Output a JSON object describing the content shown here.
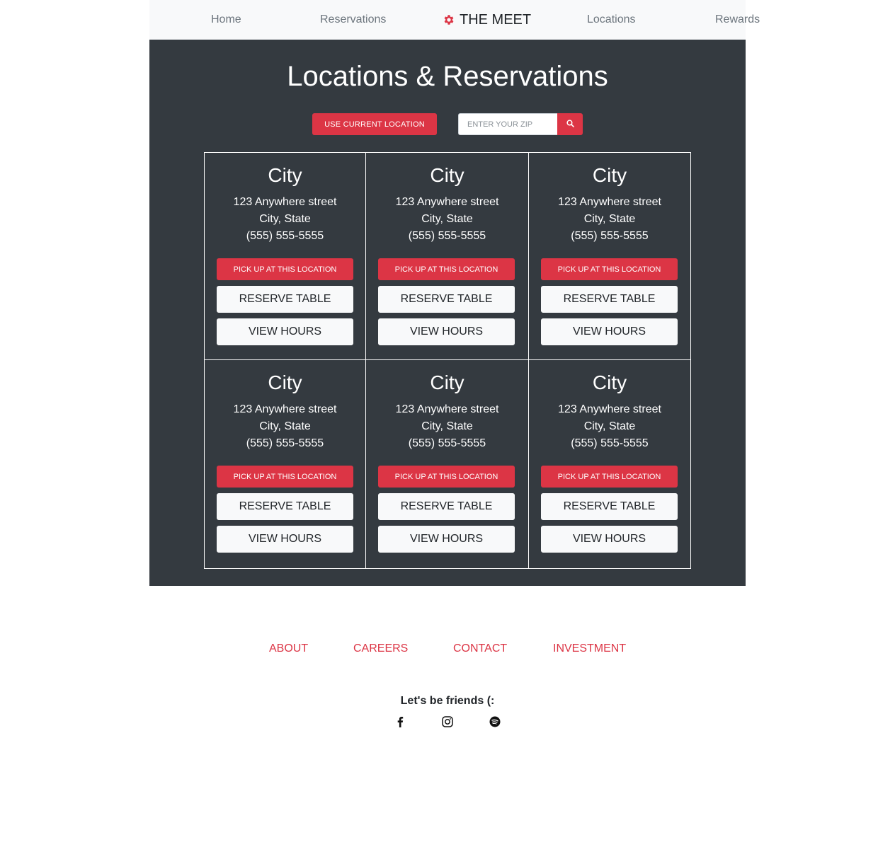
{
  "nav": {
    "home": "Home",
    "reservations": "Reservations",
    "brand": "THE MEET",
    "locations": "Locations",
    "rewards": "Rewards"
  },
  "main": {
    "title": "Locations & Reservations",
    "use_location_label": "USE CURRENT LOCATION",
    "zip_placeholder": "ENTER YOUR ZIP",
    "search_icon": "search-icon"
  },
  "locations": [
    {
      "city": "City",
      "street": "123 Anywhere street",
      "city_state": "City, State",
      "phone": "(555) 555-5555",
      "pickup": "PICK UP AT THIS LOCATION",
      "reserve": "RESERVE TABLE",
      "hours": "VIEW HOURS"
    },
    {
      "city": "City",
      "street": "123 Anywhere street",
      "city_state": "City, State",
      "phone": "(555) 555-5555",
      "pickup": "PICK UP AT THIS LOCATION",
      "reserve": "RESERVE TABLE",
      "hours": "VIEW HOURS"
    },
    {
      "city": "City",
      "street": "123 Anywhere street",
      "city_state": "City, State",
      "phone": "(555) 555-5555",
      "pickup": "PICK UP AT THIS LOCATION",
      "reserve": "RESERVE TABLE",
      "hours": "VIEW HOURS"
    },
    {
      "city": "City",
      "street": "123 Anywhere street",
      "city_state": "City, State",
      "phone": "(555) 555-5555",
      "pickup": "PICK UP AT THIS LOCATION",
      "reserve": "RESERVE TABLE",
      "hours": "VIEW HOURS"
    },
    {
      "city": "City",
      "street": "123 Anywhere street",
      "city_state": "City, State",
      "phone": "(555) 555-5555",
      "pickup": "PICK UP AT THIS LOCATION",
      "reserve": "RESERVE TABLE",
      "hours": "VIEW HOURS"
    },
    {
      "city": "City",
      "street": "123 Anywhere street",
      "city_state": "City, State",
      "phone": "(555) 555-5555",
      "pickup": "PICK UP AT THIS LOCATION",
      "reserve": "RESERVE TABLE",
      "hours": "VIEW HOURS"
    }
  ],
  "footer": {
    "about": "ABOUT",
    "careers": "CAREERS",
    "contact": "CONTACT",
    "investment": "INVESTMENT",
    "friends": "Let's be friends (:",
    "social_icons": [
      "facebook-icon",
      "instagram-icon",
      "spotify-icon"
    ]
  },
  "colors": {
    "accent": "#dc3545",
    "dark_bg": "#343a40",
    "nav_bg": "#f8f9fa"
  }
}
